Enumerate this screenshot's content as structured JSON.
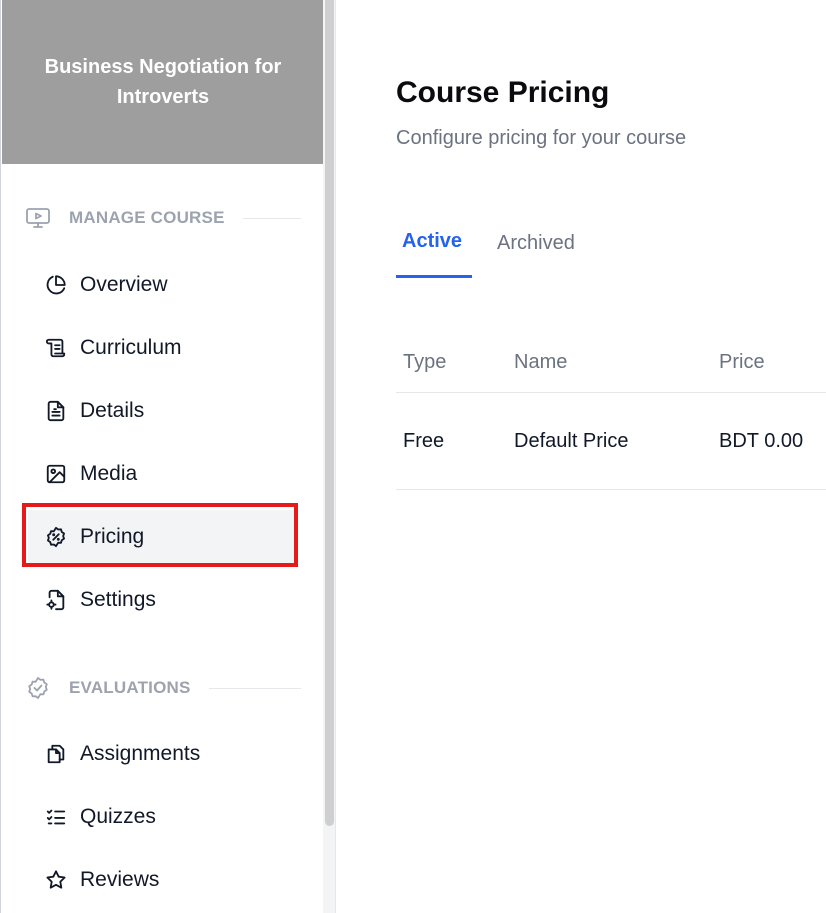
{
  "sidebar": {
    "course_title": "Business Negotiation for Introverts",
    "sections": [
      {
        "label": "MANAGE COURSE",
        "icon": "monitor-play-icon",
        "items": [
          {
            "label": "Overview",
            "icon": "pie-chart-icon"
          },
          {
            "label": "Curriculum",
            "icon": "scroll-icon"
          },
          {
            "label": "Details",
            "icon": "file-details-icon"
          },
          {
            "label": "Media",
            "icon": "image-icon"
          },
          {
            "label": "Pricing",
            "icon": "discount-badge-icon",
            "active": true
          },
          {
            "label": "Settings",
            "icon": "file-settings-icon"
          }
        ]
      },
      {
        "label": "EVALUATIONS",
        "icon": "check-badge-icon",
        "items": [
          {
            "label": "Assignments",
            "icon": "copy-file-icon"
          },
          {
            "label": "Quizzes",
            "icon": "checklist-icon"
          },
          {
            "label": "Reviews",
            "icon": "star-icon"
          }
        ]
      }
    ]
  },
  "main": {
    "title": "Course Pricing",
    "subtitle": "Configure pricing for your course",
    "tabs": [
      {
        "label": "Active",
        "active": true
      },
      {
        "label": "Archived",
        "active": false
      }
    ],
    "table": {
      "headers": [
        "Type",
        "Name",
        "Price"
      ],
      "rows": [
        [
          "Free",
          "Default Price",
          "BDT 0.00"
        ]
      ]
    }
  },
  "colors": {
    "accent": "#2563eb",
    "header_bg": "#9e9e9e",
    "highlight": "#e31b1b",
    "muted": "#6b7280"
  }
}
